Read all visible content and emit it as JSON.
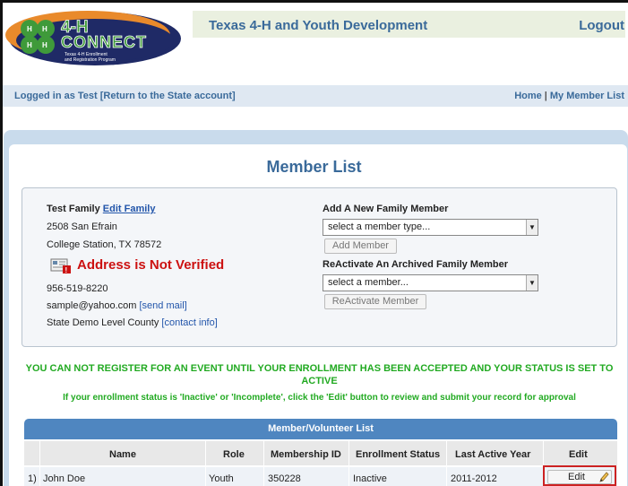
{
  "header": {
    "logo_text": "4-H CONNECT",
    "logo_tagline": "Texas 4-H Enrollment and Registration Program",
    "site_title": "Texas 4-H and Youth Development",
    "logout_label": "Logout"
  },
  "session_bar": {
    "logged_in_text": "Logged in as Test [Return to the State account]",
    "home_label": "Home",
    "separator": "|",
    "member_list_label": "My Member List"
  },
  "page": {
    "title": "Member List"
  },
  "family": {
    "name": "Test Family",
    "edit_label": "Edit Family",
    "street": "2508 San Efrain",
    "city_state_zip": "College Station, TX 78572",
    "address_status": "Address is Not Verified",
    "phone": "956-519-8220",
    "email": "sample@yahoo.com",
    "send_mail_label": "[send mail]",
    "county": "State Demo Level County",
    "contact_info_label": "[contact info]"
  },
  "add_member": {
    "heading": "Add A New Family Member",
    "select_value": "select a member type...",
    "button_label": "Add Member"
  },
  "reactivate": {
    "heading": "ReActivate An Archived Family Member",
    "select_value": "select a member...",
    "button_label": "ReActivate Member"
  },
  "notices": {
    "line1": "YOU CAN NOT REGISTER FOR AN EVENT UNTIL YOUR ENROLLMENT HAS BEEN ACCEPTED AND YOUR STATUS IS SET TO ACTIVE",
    "line2": "If your enrollment status is 'Inactive' or 'Incomplete', click the 'Edit' button to review and submit your record for approval"
  },
  "member_table": {
    "title": "Member/Volunteer List",
    "columns": [
      "Name",
      "Role",
      "Membership ID",
      "Enrollment Status",
      "Last Active Year",
      "Edit"
    ],
    "rows": [
      {
        "index": "1)",
        "name": "John Doe",
        "role": "Youth",
        "membership_id": "350228",
        "status": "Inactive",
        "last_active_year": "2011-2012",
        "edit_label": "Edit"
      }
    ]
  },
  "icons": {
    "select_arrow": "dropdown-arrow-icon",
    "unverified": "address-warning-icon",
    "edit": "pencil-icon"
  },
  "colors": {
    "brand_blue": "#3a6a9a",
    "link_blue": "#2255aa",
    "warning_red": "#cc1111",
    "notice_green": "#22aa22",
    "table_header": "#4f86c0",
    "logo_green": "#3f9a3a",
    "logo_navy": "#1f2a66",
    "logo_orange": "#e98a2b"
  }
}
